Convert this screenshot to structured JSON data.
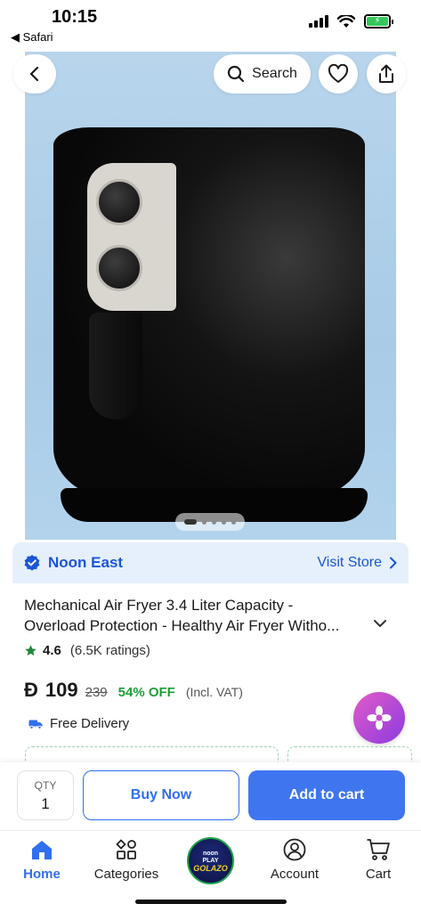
{
  "status_bar": {
    "time": "10:15",
    "back_app": "◀ Safari"
  },
  "header": {
    "search_label": "Search"
  },
  "gallery": {
    "image_count": 5,
    "active_index": 0
  },
  "store": {
    "name": "Noon East",
    "visit_label": "Visit Store"
  },
  "product": {
    "title_line1": "Mechanical Air Fryer 3.4 Liter Capacity -",
    "title_line2": "Overload Protection - Healthy Air Fryer Witho...",
    "rating": "4.6",
    "rating_count": "(6.5K ratings)",
    "currency_symbol": "Đ",
    "price": "109",
    "old_price": "239",
    "discount": "54% OFF",
    "vat_note": "(Incl. VAT)",
    "delivery": "Free Delivery"
  },
  "actions": {
    "qty_label": "QTY",
    "qty_value": "1",
    "buy_now": "Buy Now",
    "add_to_cart": "Add to cart"
  },
  "tabs": {
    "home": "Home",
    "categories": "Categories",
    "center_logo_line1": "noon",
    "center_logo_line2": "PLAY",
    "center_logo_line3": "GOLAZO",
    "account": "Account",
    "cart": "Cart"
  },
  "colors": {
    "accent_blue": "#2f6ff0",
    "discount_green": "#1e9e3a",
    "store_bg": "#e6f0fc"
  },
  "icons": [
    "back-icon",
    "search-icon",
    "heart-icon",
    "share-icon",
    "verified-badge-icon",
    "chevron-right-icon",
    "chevron-down-icon",
    "star-icon",
    "delivery-truck-icon",
    "flower-assistant-icon",
    "home-icon",
    "categories-icon",
    "account-icon",
    "cart-icon"
  ]
}
